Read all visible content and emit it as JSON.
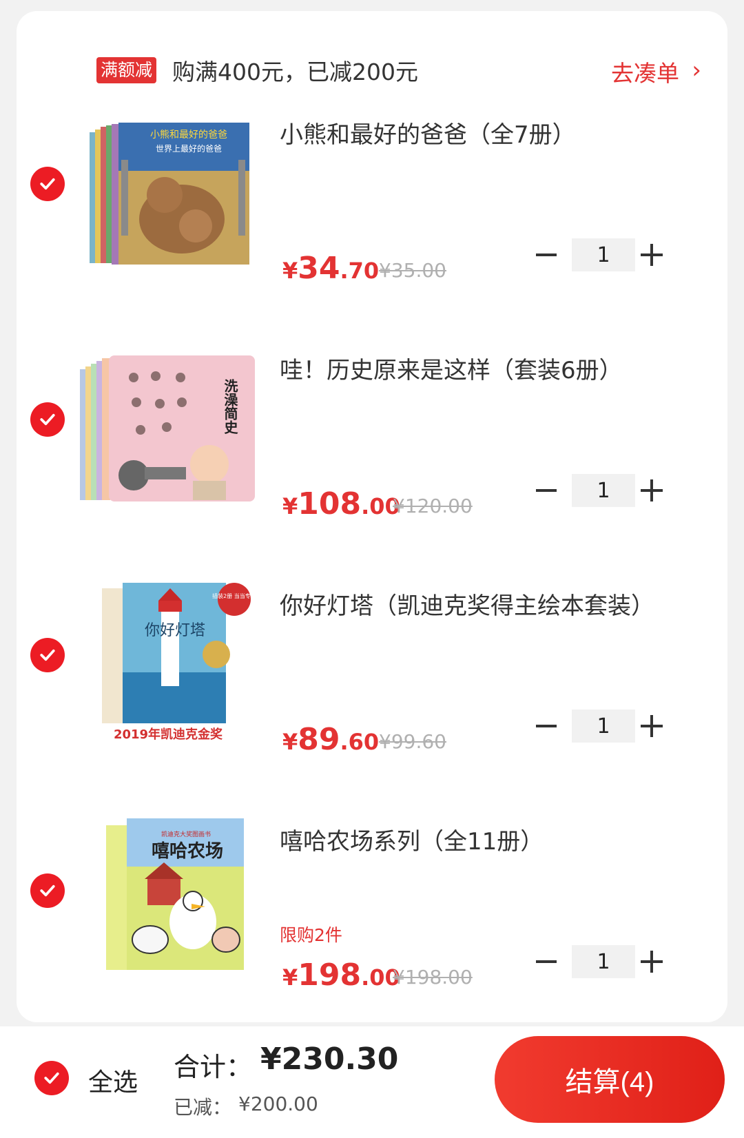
{
  "promo": {
    "tag": "满额减",
    "text": "购满400元，已减200元",
    "link": "去凑单",
    "link_icon": "chevron-right-icon"
  },
  "items": [
    {
      "title": "小熊和最好的爸爸（全7册）",
      "limit": "",
      "price_yen": "¥",
      "price_int": "34",
      "price_dec": ".70",
      "orig": "¥35.00",
      "qty": "1",
      "cover_text": "小熊和最好的爸爸",
      "cover_sub": "世界上最好的爸爸",
      "cover_color": "#3a6fb0"
    },
    {
      "title": "哇！历史原来是这样（套装6册）",
      "limit": "",
      "price_yen": "¥",
      "price_int": "108",
      "price_dec": ".00",
      "orig": "¥120.00",
      "qty": "1",
      "cover_text": "洗澡简史",
      "cover_sub": "",
      "cover_color": "#f3c6cf"
    },
    {
      "title": "你好灯塔（凯迪克奖得主绘本套装）",
      "limit": "",
      "price_yen": "¥",
      "price_int": "89",
      "price_dec": ".60",
      "orig": "¥99.60",
      "qty": "1",
      "cover_text": "你好灯塔",
      "cover_sub": "2019年凯迪克金奖",
      "cover_badge": "插装2册 当当专供",
      "cover_color": "#6fb7d9"
    },
    {
      "title": "嘻哈农场系列（全11册）",
      "limit": "限购2件",
      "price_yen": "¥",
      "price_int": "198",
      "price_dec": ".00",
      "orig": "¥198.00",
      "qty": "1",
      "cover_text": "嘻哈农场",
      "cover_sub": "凯迪克大奖图画书",
      "cover_color": "#dbe77a"
    }
  ],
  "bottom": {
    "select_all": "全选",
    "total_label": "合计：",
    "total": "¥230.30",
    "reduced_label": "已减：",
    "reduced": "¥200.00",
    "checkout": "结算(4)"
  },
  "colors": {
    "accent": "#e33333",
    "check": "#ec1c24"
  }
}
